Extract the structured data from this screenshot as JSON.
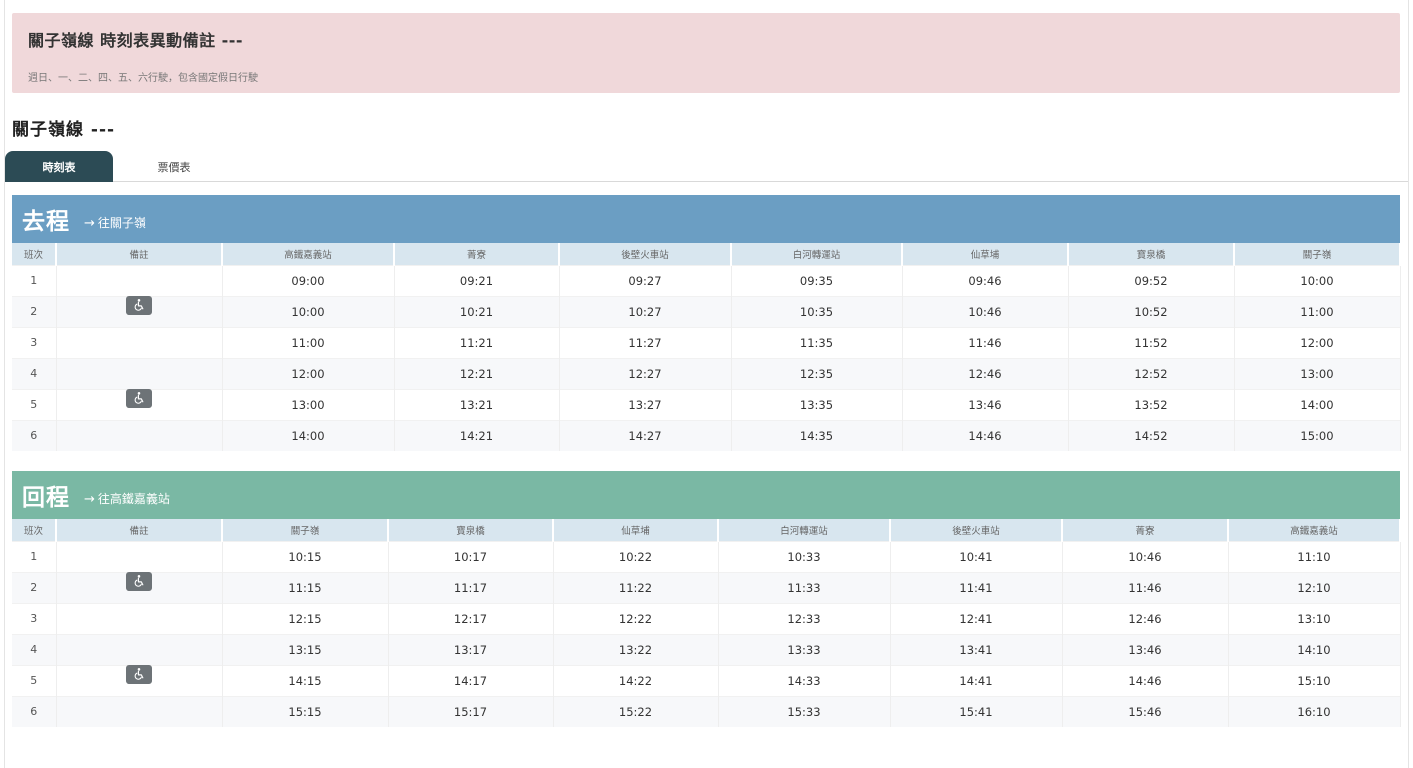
{
  "notice": {
    "title": "關子嶺線 時刻表異動備註 ---",
    "text": "週日、一、二、四、五、六行駛，包含國定假日行駛"
  },
  "route_title": "關子嶺線 ---",
  "tabs": [
    {
      "label": "時刻表",
      "active": true
    },
    {
      "label": "票價表",
      "active": false
    }
  ],
  "colors": {
    "outbound_header": "#6b9ec3",
    "return_header": "#7ab8a4",
    "notice_bg": "#f0d8da",
    "tab_active": "#2c4b55"
  },
  "outbound": {
    "title": "去程",
    "arrow": "→",
    "direction": "往關子嶺",
    "columns": [
      "班次",
      "備註",
      "高鐵嘉義站",
      "菁寮",
      "後壁火車站",
      "白河轉運站",
      "仙草埔",
      "寶泉橋",
      "關子嶺"
    ],
    "rows": [
      {
        "no": "1",
        "accessible": false,
        "times": [
          "09:00",
          "09:21",
          "09:27",
          "09:35",
          "09:46",
          "09:52",
          "10:00"
        ]
      },
      {
        "no": "2",
        "accessible": true,
        "times": [
          "10:00",
          "10:21",
          "10:27",
          "10:35",
          "10:46",
          "10:52",
          "11:00"
        ]
      },
      {
        "no": "3",
        "accessible": false,
        "times": [
          "11:00",
          "11:21",
          "11:27",
          "11:35",
          "11:46",
          "11:52",
          "12:00"
        ]
      },
      {
        "no": "4",
        "accessible": false,
        "times": [
          "12:00",
          "12:21",
          "12:27",
          "12:35",
          "12:46",
          "12:52",
          "13:00"
        ]
      },
      {
        "no": "5",
        "accessible": true,
        "times": [
          "13:00",
          "13:21",
          "13:27",
          "13:35",
          "13:46",
          "13:52",
          "14:00"
        ]
      },
      {
        "no": "6",
        "accessible": false,
        "times": [
          "14:00",
          "14:21",
          "14:27",
          "14:35",
          "14:46",
          "14:52",
          "15:00"
        ]
      }
    ]
  },
  "return": {
    "title": "回程",
    "arrow": "→",
    "direction": "往高鐵嘉義站",
    "columns": [
      "班次",
      "備註",
      "關子嶺",
      "寶泉橋",
      "仙草埔",
      "白河轉運站",
      "後壁火車站",
      "菁寮",
      "高鐵嘉義站"
    ],
    "rows": [
      {
        "no": "1",
        "accessible": false,
        "times": [
          "10:15",
          "10:17",
          "10:22",
          "10:33",
          "10:41",
          "10:46",
          "11:10"
        ]
      },
      {
        "no": "2",
        "accessible": true,
        "times": [
          "11:15",
          "11:17",
          "11:22",
          "11:33",
          "11:41",
          "11:46",
          "12:10"
        ]
      },
      {
        "no": "3",
        "accessible": false,
        "times": [
          "12:15",
          "12:17",
          "12:22",
          "12:33",
          "12:41",
          "12:46",
          "13:10"
        ]
      },
      {
        "no": "4",
        "accessible": false,
        "times": [
          "13:15",
          "13:17",
          "13:22",
          "13:33",
          "13:41",
          "13:46",
          "14:10"
        ]
      },
      {
        "no": "5",
        "accessible": true,
        "times": [
          "14:15",
          "14:17",
          "14:22",
          "14:33",
          "14:41",
          "14:46",
          "15:10"
        ]
      },
      {
        "no": "6",
        "accessible": false,
        "times": [
          "15:15",
          "15:17",
          "15:22",
          "15:33",
          "15:41",
          "15:46",
          "16:10"
        ]
      }
    ]
  },
  "icons": {
    "accessible": "wheelchair-icon"
  }
}
